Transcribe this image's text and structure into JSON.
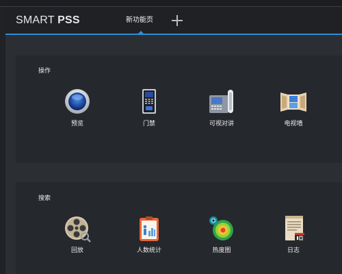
{
  "app": {
    "logo_light": "SMART ",
    "logo_bold": "PSS"
  },
  "tabs": [
    {
      "label": "新功能页"
    }
  ],
  "sections": [
    {
      "title": "操作",
      "items": [
        {
          "label": "预览",
          "icon": "preview-camera-icon"
        },
        {
          "label": "门禁",
          "icon": "access-control-icon"
        },
        {
          "label": "可视对讲",
          "icon": "video-intercom-icon"
        },
        {
          "label": "电视墙",
          "icon": "tv-wall-icon"
        }
      ]
    },
    {
      "title": "搜索",
      "items": [
        {
          "label": "回放",
          "icon": "playback-reel-icon"
        },
        {
          "label": "人数统计",
          "icon": "people-counting-icon"
        },
        {
          "label": "热度图",
          "icon": "heatmap-icon"
        },
        {
          "label": "日志",
          "icon": "log-icon"
        }
      ]
    }
  ],
  "colors": {
    "accent": "#2a8fd6",
    "titlebar": "#1f2125",
    "panel": "#25282d",
    "background": "#2b2e33"
  }
}
